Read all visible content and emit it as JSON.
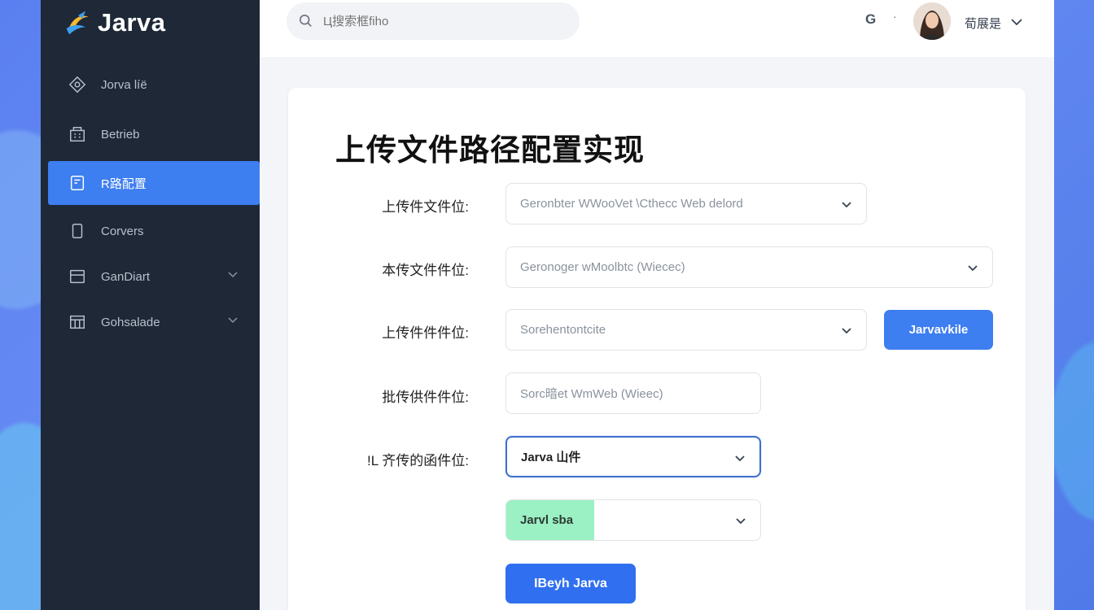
{
  "colors": {
    "sidebar_bg": "#1e2836",
    "accent": "#3d7ef0",
    "success_tag": "#9bf0c4",
    "page_bg": "#f3f5f9"
  },
  "app": {
    "logo_text": "Jarva"
  },
  "sidebar": {
    "items": [
      {
        "label": "Jorva líë",
        "icon": "diamond-icon",
        "active": false,
        "has_chevron": false
      },
      {
        "label": "Betrieb",
        "icon": "building-icon",
        "active": false,
        "has_chevron": false
      },
      {
        "label": "R路配置",
        "icon": "config-icon",
        "active": true,
        "has_chevron": false
      },
      {
        "label": "Corvers",
        "icon": "phone-icon",
        "active": false,
        "has_chevron": false
      },
      {
        "label": "GanDiart",
        "icon": "window-icon",
        "active": false,
        "has_chevron": true
      },
      {
        "label": "Gohsalade",
        "icon": "grid-icon",
        "active": false,
        "has_chevron": true
      }
    ]
  },
  "header": {
    "search_placeholder": "Ц搜索框fiho",
    "g_label": "G",
    "dot": "·",
    "user_name": "荀展是"
  },
  "form": {
    "title": "上传文件路径配置实现",
    "rows": [
      {
        "label": "上传件文件位:",
        "value": "Geronbter WWooVet \\Cthecc Web delord"
      },
      {
        "label": "本传文件件位:",
        "value": "Geronoger wMoolbtc (Wiecec)"
      },
      {
        "label": "上传件件件位:",
        "value": "Sorehentontcite",
        "button": "Jarvavkile"
      },
      {
        "label": "批传供件件位:",
        "value": "Sorc暗et WmWeb (Wieec)"
      },
      {
        "label": "!L 齐传的函件位:",
        "value": "Jarva 山件"
      },
      {
        "tag": "Jarvl sba"
      }
    ],
    "submit": "IBeyh Jarva"
  }
}
